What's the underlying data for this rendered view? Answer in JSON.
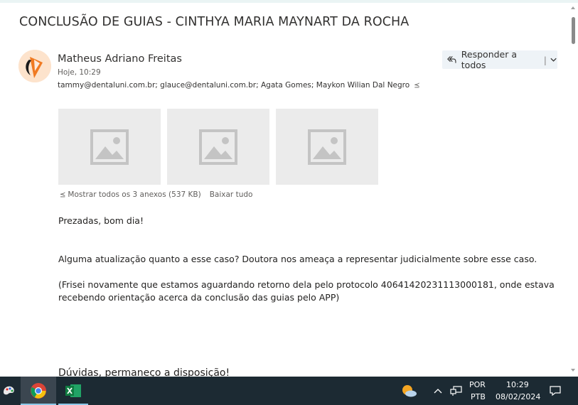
{
  "email": {
    "subject": "CONCLUSÃO DE GUIAS - CINTHYA MARIA MAYNART DA ROCHA",
    "sender": "Matheus Adriano Freitas",
    "date": "Hoje, 10:29",
    "recipients": "tammy@dentaluni.com.br; glauce@dentaluni.com.br; Agata Gomes; Maykon Wilian Dal Negro",
    "reply_label": "Responder a todos",
    "attachments": {
      "show_all": "Mostrar todos os 3 anexos (537 KB)",
      "download_all": "Baixar tudo"
    },
    "body": {
      "greeting": "Prezadas, bom dia!",
      "line1": "Alguma atualização quanto a esse caso? Doutora nos ameaça a representar judicialmente sobre esse caso.",
      "line2": "(Frisei novamente que estamos aguardando retorno dela pelo protocolo 40641420231113000181, onde estava",
      "line3": "recebendo orientação acerca da conclusão das guias pelo APP)",
      "closing": "Dúvidas, permaneço a disposição!"
    }
  },
  "taskbar": {
    "lang_top": "POR",
    "lang_bottom": "PTB",
    "time": "10:29",
    "date": "08/02/2024",
    "icons": [
      "paint-icon",
      "chrome-icon",
      "excel-icon",
      "weather-icon",
      "chevron-up-icon",
      "network-icon",
      "notification-icon"
    ]
  },
  "colors": {
    "accent": "#0078d4",
    "taskbar": "#1c2a33",
    "reply_bg": "#eef3f7",
    "thumb_bg": "#ebebeb",
    "avatar_bg": "#fde3cc"
  }
}
